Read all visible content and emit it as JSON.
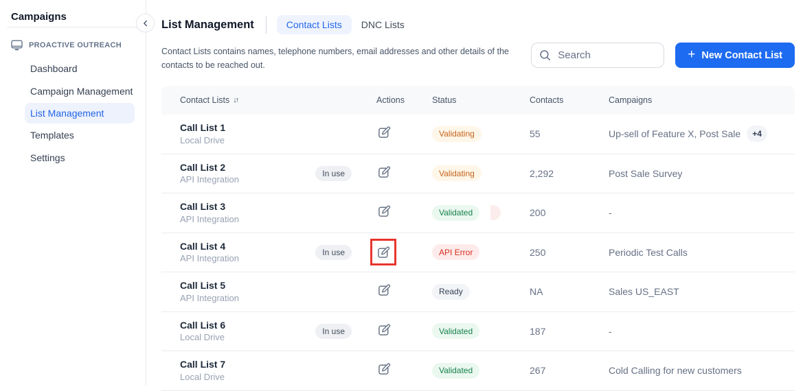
{
  "sidebar": {
    "title": "Campaigns",
    "section_label": "PROACTIVE OUTREACH",
    "items": [
      {
        "label": "Dashboard",
        "active": false
      },
      {
        "label": "Campaign Management",
        "active": false
      },
      {
        "label": "List Management",
        "active": true
      },
      {
        "label": "Templates",
        "active": false
      },
      {
        "label": "Settings",
        "active": false
      }
    ]
  },
  "header": {
    "title": "List Management",
    "tabs": [
      {
        "label": "Contact Lists",
        "active": true
      },
      {
        "label": "DNC Lists",
        "active": false
      }
    ],
    "description": "Contact Lists contains names, telephone numbers, email addresses and other details of the contacts to be reached out.",
    "search_placeholder": "Search",
    "new_button_label": "New Contact List"
  },
  "icons": {
    "plus": "+",
    "sort": "↓↑",
    "chevron_left": "‹",
    "monitor": "monitor-icon",
    "search": "search-icon",
    "edit": "edit-pencil-square-icon"
  },
  "table": {
    "columns": [
      "Contact Lists",
      "Actions",
      "Status",
      "Contacts",
      "Campaigns"
    ],
    "in_use_label": "In use",
    "rows": [
      {
        "name": "Call List 1",
        "source": "Local Drive",
        "in_use": false,
        "status": "Validating",
        "status_type": "warning",
        "contacts": "55",
        "campaigns": "Up-sell of Feature X, Post Sale",
        "campaigns_extra": "+4",
        "highlighted": false
      },
      {
        "name": "Call List 2",
        "source": "API Integration",
        "in_use": true,
        "status": "Validating",
        "status_type": "warning",
        "contacts": "2,292",
        "campaigns": "Post Sale Survey",
        "campaigns_extra": "",
        "highlighted": false
      },
      {
        "name": "Call List 3",
        "source": "API Integration",
        "in_use": false,
        "status": "Validated",
        "status_type": "success",
        "contacts": "200",
        "campaigns": "-",
        "campaigns_extra": "",
        "highlighted": false
      },
      {
        "name": "Call List 4",
        "source": "API Integration",
        "in_use": true,
        "status": "API Error",
        "status_type": "danger",
        "contacts": "250",
        "campaigns": "Periodic Test Calls",
        "campaigns_extra": "",
        "highlighted": true
      },
      {
        "name": "Call List 5",
        "source": "API Integration",
        "in_use": false,
        "status": "Ready",
        "status_type": "neutral",
        "contacts": "NA",
        "campaigns": "Sales US_EAST",
        "campaigns_extra": "",
        "highlighted": false
      },
      {
        "name": "Call List 6",
        "source": "Local Drive",
        "in_use": true,
        "status": "Validated",
        "status_type": "success",
        "contacts": "187",
        "campaigns": "-",
        "campaigns_extra": "",
        "highlighted": false
      },
      {
        "name": "Call List 7",
        "source": "Local Drive",
        "in_use": false,
        "status": "Validated",
        "status_type": "success",
        "contacts": "267",
        "campaigns": "Cold Calling for new customers",
        "campaigns_extra": "",
        "highlighted": false
      }
    ]
  },
  "colors": {
    "accent_blue": "#1D6BF0",
    "active_tab_bg": "#EEF3FE",
    "status_warning": "#C4641D",
    "status_success": "#17814B",
    "status_danger": "#D92D20",
    "status_neutral": "#344054",
    "annotation_highlight": "#E8352E"
  }
}
